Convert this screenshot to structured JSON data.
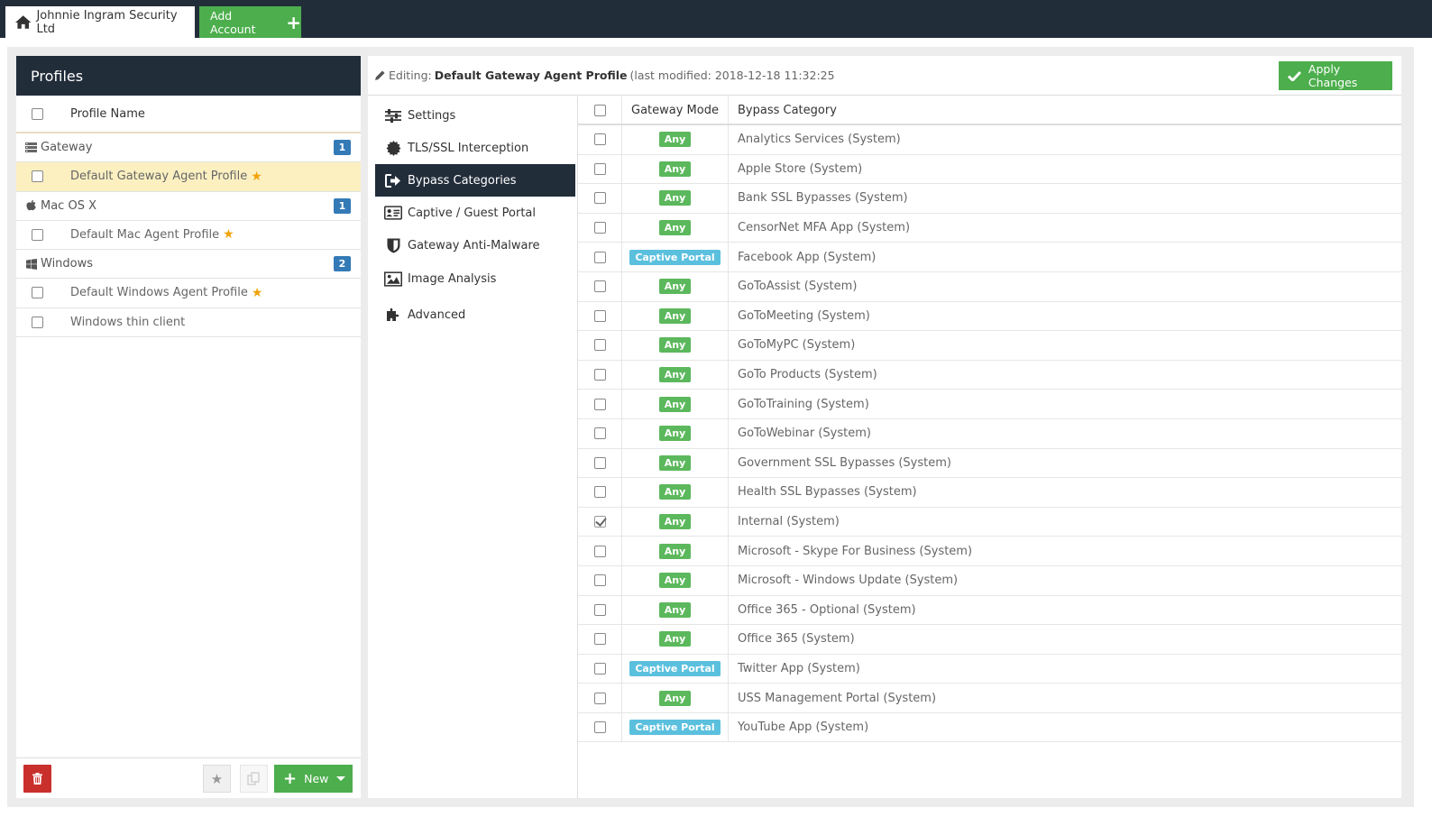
{
  "topbar": {
    "account_name": "Johnnie Ingram Security Ltd",
    "add_account_label": "Add Account"
  },
  "profiles": {
    "title": "Profiles",
    "column_header": "Profile Name",
    "groups": [
      {
        "name": "Gateway",
        "count": "1",
        "icon": "server-icon",
        "items": [
          {
            "name": "Default Gateway Agent Profile",
            "default": true,
            "selected": true
          }
        ]
      },
      {
        "name": "Mac OS X",
        "count": "1",
        "icon": "apple-icon",
        "items": [
          {
            "name": "Default Mac Agent Profile",
            "default": true,
            "selected": false
          }
        ]
      },
      {
        "name": "Windows",
        "count": "2",
        "icon": "windows-icon",
        "items": [
          {
            "name": "Default Windows Agent Profile",
            "default": true,
            "selected": false
          },
          {
            "name": "Windows thin client",
            "default": false,
            "selected": false
          }
        ]
      }
    ],
    "footer": {
      "new_label": "New"
    }
  },
  "editor": {
    "editing_prefix": "Editing:",
    "profile_name": "Default Gateway Agent Profile",
    "last_modified": "(last modified: 2018-12-18 11:32:25",
    "apply_label": "Apply Changes",
    "nav": [
      {
        "label": "Settings",
        "icon": "sliders-icon",
        "active": false
      },
      {
        "label": "TLS/SSL Interception",
        "icon": "certificate-icon",
        "active": false
      },
      {
        "label": "Bypass Categories",
        "icon": "sign-out-icon",
        "active": true
      },
      {
        "label": "Captive / Guest Portal",
        "icon": "id-card-icon",
        "active": false
      },
      {
        "label": "Gateway Anti-Malware",
        "icon": "shield-icon",
        "active": false
      },
      {
        "label": "Image Analysis",
        "icon": "image-icon",
        "active": false
      },
      {
        "label": "Advanced",
        "icon": "puzzle-icon",
        "active": false
      }
    ],
    "table": {
      "headers": {
        "mode": "Gateway Mode",
        "category": "Bypass Category"
      },
      "rows": [
        {
          "mode": "Any",
          "category": "Analytics Services (System)",
          "checked": false
        },
        {
          "mode": "Any",
          "category": "Apple Store (System)",
          "checked": false
        },
        {
          "mode": "Any",
          "category": "Bank SSL Bypasses (System)",
          "checked": false
        },
        {
          "mode": "Any",
          "category": "CensorNet MFA App (System)",
          "checked": false
        },
        {
          "mode": "Captive Portal",
          "category": "Facebook App (System)",
          "checked": false
        },
        {
          "mode": "Any",
          "category": "GoToAssist (System)",
          "checked": false
        },
        {
          "mode": "Any",
          "category": "GoToMeeting (System)",
          "checked": false
        },
        {
          "mode": "Any",
          "category": "GoToMyPC (System)",
          "checked": false
        },
        {
          "mode": "Any",
          "category": "GoTo Products (System)",
          "checked": false
        },
        {
          "mode": "Any",
          "category": "GoToTraining (System)",
          "checked": false
        },
        {
          "mode": "Any",
          "category": "GoToWebinar (System)",
          "checked": false
        },
        {
          "mode": "Any",
          "category": "Government SSL Bypasses (System)",
          "checked": false
        },
        {
          "mode": "Any",
          "category": "Health SSL Bypasses (System)",
          "checked": false
        },
        {
          "mode": "Any",
          "category": "Internal (System)",
          "checked": true
        },
        {
          "mode": "Any",
          "category": "Microsoft - Skype For Business (System)",
          "checked": false
        },
        {
          "mode": "Any",
          "category": "Microsoft - Windows Update (System)",
          "checked": false
        },
        {
          "mode": "Any",
          "category": "Office 365 - Optional (System)",
          "checked": false
        },
        {
          "mode": "Any",
          "category": "Office 365 (System)",
          "checked": false
        },
        {
          "mode": "Captive Portal",
          "category": "Twitter App (System)",
          "checked": false
        },
        {
          "mode": "Any",
          "category": "USS Management Portal (System)",
          "checked": false
        },
        {
          "mode": "Captive Portal",
          "category": "YouTube App (System)",
          "checked": false
        }
      ]
    }
  },
  "colors": {
    "navbar": "#222d3a",
    "success": "#4cae4c",
    "badge_any": "#5cb85c",
    "badge_captive": "#5bc0de",
    "danger": "#c9302c",
    "count_badge": "#337ab7",
    "selected_row": "#fcf0c1"
  }
}
